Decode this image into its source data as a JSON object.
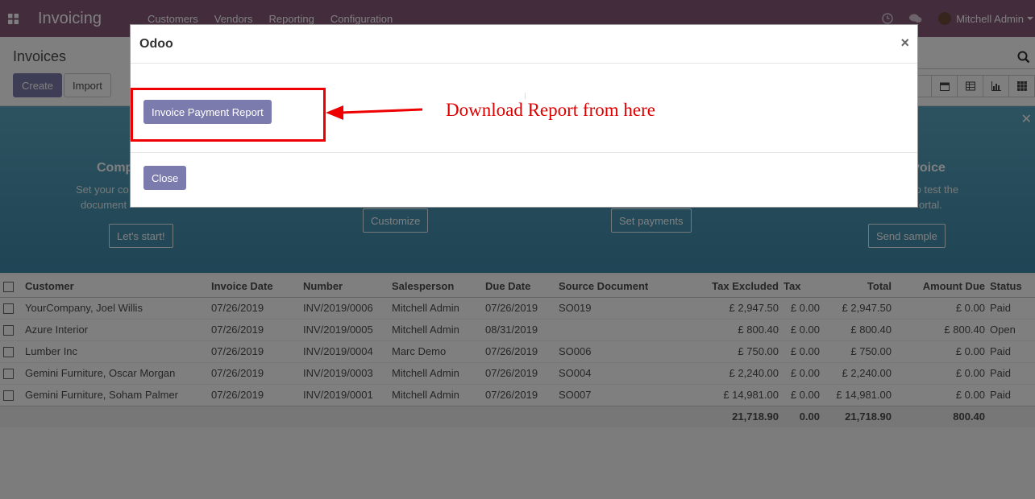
{
  "navbar": {
    "app_title": "Invoicing",
    "menu": [
      "Customers",
      "Vendors",
      "Reporting",
      "Configuration"
    ],
    "user_name": "Mitchell Admin"
  },
  "control_panel": {
    "breadcrumb": "Invoices",
    "create_label": "Create",
    "import_label": "Import"
  },
  "onboarding": {
    "steps": [
      {
        "title": "Comp",
        "desc_1": "Set your co",
        "desc_2": "document",
        "button": "Let's start!"
      },
      {
        "button": "Customize"
      },
      {
        "button": "Set payments"
      },
      {
        "title": "voice",
        "desc_1": "to test the",
        "desc_2": "ortal.",
        "button": "Send sample"
      }
    ]
  },
  "table": {
    "columns": [
      "Customer",
      "Invoice Date",
      "Number",
      "Salesperson",
      "Due Date",
      "Source Document",
      "Tax Excluded",
      "Tax",
      "Total",
      "Amount Due",
      "Status"
    ],
    "rows": [
      [
        "YourCompany, Joel Willis",
        "07/26/2019",
        "INV/2019/0006",
        "Mitchell Admin",
        "07/26/2019",
        "SO019",
        "£ 2,947.50",
        "£ 0.00",
        "£ 2,947.50",
        "£ 0.00",
        "Paid"
      ],
      [
        "Azure Interior",
        "07/26/2019",
        "INV/2019/0005",
        "Mitchell Admin",
        "08/31/2019",
        "",
        "£ 800.40",
        "£ 0.00",
        "£ 800.40",
        "£ 800.40",
        "Open"
      ],
      [
        "Lumber Inc",
        "07/26/2019",
        "INV/2019/0004",
        "Marc Demo",
        "07/26/2019",
        "SO006",
        "£ 750.00",
        "£ 0.00",
        "£ 750.00",
        "£ 0.00",
        "Paid"
      ],
      [
        "Gemini Furniture, Oscar Morgan",
        "07/26/2019",
        "INV/2019/0003",
        "Mitchell Admin",
        "07/26/2019",
        "SO004",
        "£ 2,240.00",
        "£ 0.00",
        "£ 2,240.00",
        "£ 0.00",
        "Paid"
      ],
      [
        "Gemini Furniture, Soham Palmer",
        "07/26/2019",
        "INV/2019/0001",
        "Mitchell Admin",
        "07/26/2019",
        "SO007",
        "£ 14,981.00",
        "£ 0.00",
        "£ 14,981.00",
        "£ 0.00",
        "Paid"
      ]
    ],
    "totals": {
      "tax_excluded": "21,718.90",
      "tax": "0.00",
      "total": "21,718.90",
      "amount_due": "800.40"
    }
  },
  "modal": {
    "title": "Odoo",
    "close_x": "×",
    "report_button": "Invoice Payment Report",
    "annotation": "Download Report from here",
    "close_button": "Close"
  },
  "colors": {
    "navbar": "#875a7b",
    "primary_button": "#7c7bad",
    "annotation_red": "#e00000",
    "banner": "#4a95b4"
  }
}
